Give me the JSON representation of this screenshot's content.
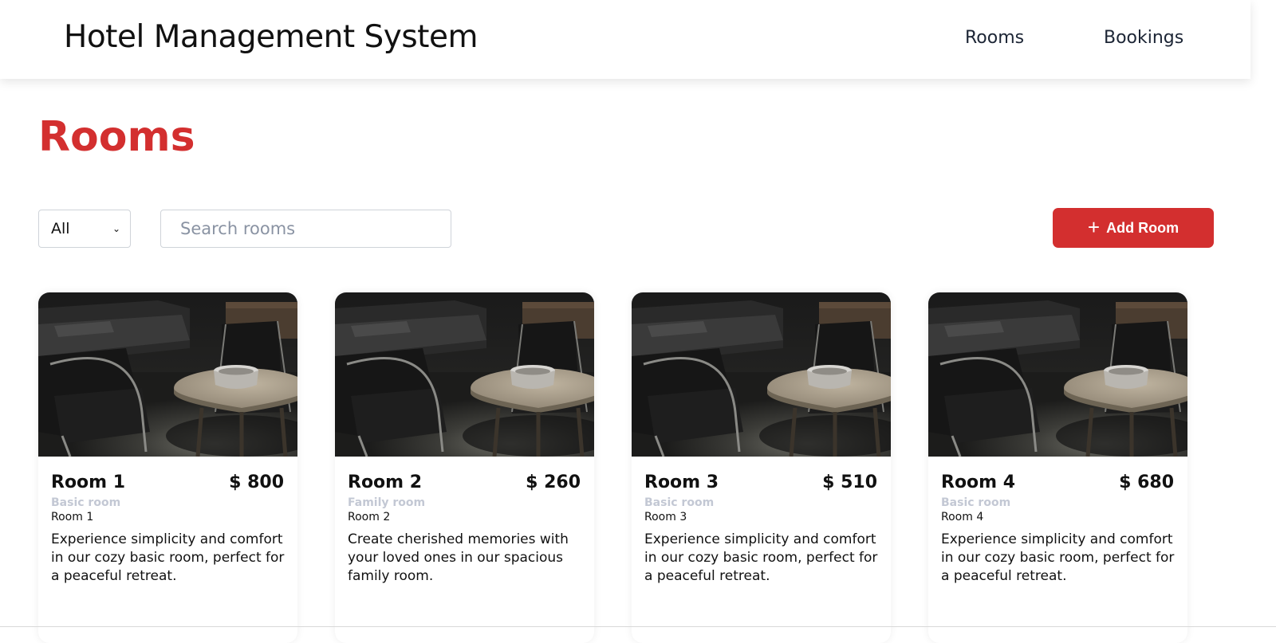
{
  "header": {
    "brand": "Hotel Management System",
    "nav": [
      {
        "label": "Rooms"
      },
      {
        "label": "Bookings"
      }
    ]
  },
  "page": {
    "title": "Rooms",
    "accent_color": "#d32f2f"
  },
  "toolbar": {
    "filter_value": "All",
    "search_placeholder": "Search rooms",
    "add_button_label": "Add Room",
    "add_button_icon": "plus-icon"
  },
  "rooms": [
    {
      "name": "Room 1",
      "price": "$ 800",
      "type": "Basic room",
      "subtitle": "Room 1",
      "description": "Experience simplicity and comfort in our cozy basic room, perfect for a peaceful retreat."
    },
    {
      "name": "Room 2",
      "price": "$ 260",
      "type": "Family room",
      "subtitle": "Room 2",
      "description": "Create cherished memories with your loved ones in our spacious family room."
    },
    {
      "name": "Room 3",
      "price": "$ 510",
      "type": "Basic room",
      "subtitle": "Room 3",
      "description": "Experience simplicity and comfort in our cozy basic room, perfect for a peaceful retreat."
    },
    {
      "name": "Room 4",
      "price": "$ 680",
      "type": "Basic room",
      "subtitle": "Room 4",
      "description": "Experience simplicity and comfort in our cozy basic room, perfect for a peaceful retreat."
    }
  ]
}
